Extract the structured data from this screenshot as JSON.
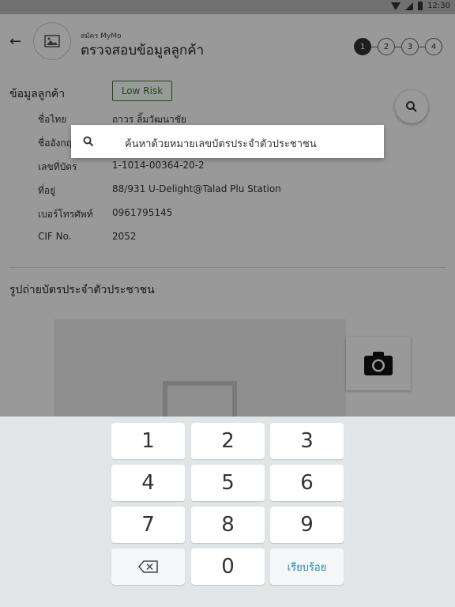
{
  "status_bar": {
    "time": "12:30"
  },
  "header": {
    "subtitle": "สมัคร MyMo",
    "title": "ตรวจสอบข้อมูลลูกค้า",
    "steps": [
      "1",
      "2",
      "3",
      "4"
    ],
    "active_step": 1
  },
  "customer_section": {
    "title": "ข้อมูลลูกค้า",
    "risk_badge": "Low Risk",
    "fields": [
      {
        "label": "ชื่อไทย",
        "value": "ถาวร ลิ้มวัฒนาชัย"
      },
      {
        "label": "ชื่ออังกฤษ",
        "value": ""
      },
      {
        "label": "เลขที่บัตร",
        "value": "1-1014-00364-20-2"
      },
      {
        "label": "ที่อยู่",
        "value": "88/931 U-Delight@Talad Plu Station"
      },
      {
        "label": "เบอร์โทรศัพท์",
        "value": "0961795145"
      },
      {
        "label": "CIF No.",
        "value": "2052"
      }
    ]
  },
  "photo_section": {
    "title": "รูปถ่ายบัตรประจำตัวประชาชน"
  },
  "search": {
    "placeholder": "ค้นหาด้วยหมายเลขบัตรประจำตัวประชาชน"
  },
  "keyboard": {
    "keys": [
      "1",
      "2",
      "3",
      "4",
      "5",
      "6",
      "7",
      "8",
      "9"
    ],
    "zero": "0",
    "done_label": "เรียบร้อย"
  }
}
